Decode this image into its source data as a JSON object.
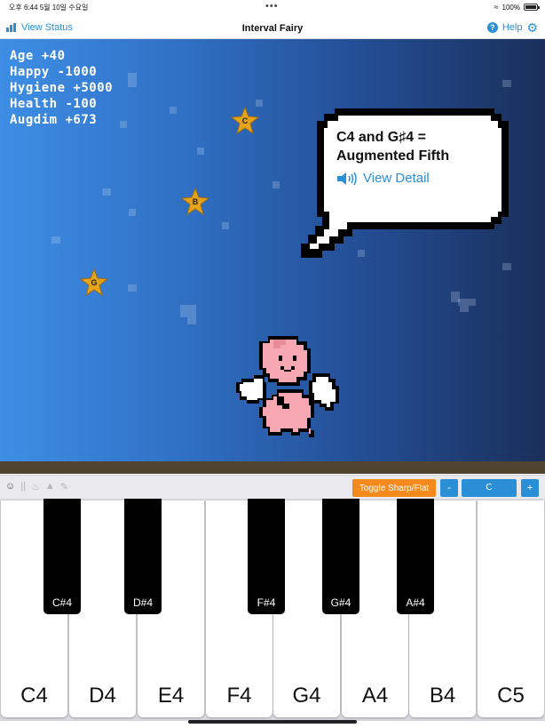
{
  "status_bar": {
    "time": "오후 6:44   5월 10일 수요일",
    "dots": "•••",
    "battery": "100%"
  },
  "nav": {
    "left_label": "View Status",
    "title": "Interval Fairy",
    "help_label": "Help"
  },
  "stats": [
    {
      "text": "Age +40"
    },
    {
      "text": "Happy -1000"
    },
    {
      "text": "Hygiene +5000"
    },
    {
      "text": "Health -100"
    },
    {
      "text": "Augdim +673"
    }
  ],
  "stars": [
    {
      "label": "C"
    },
    {
      "label": "B"
    },
    {
      "label": "G"
    }
  ],
  "bubble": {
    "title_line1": "C4 and G♯4 =",
    "title_line2": "Augmented Fifth",
    "link": "View Detail"
  },
  "toolbar": {
    "icons": [
      "smiley-icon",
      "fork-icon",
      "bath-icon",
      "megaphone-icon",
      "pencil-icon"
    ],
    "toggle_label": "Toggle Sharp/Flat",
    "minus_label": "-",
    "key_value": "C",
    "plus_label": "+"
  },
  "piano": {
    "white_keys": [
      "C4",
      "D4",
      "E4",
      "F4",
      "G4",
      "A4",
      "B4",
      "C5"
    ],
    "black_keys": [
      "C#4",
      "D#4",
      "F#4",
      "G#4",
      "A#4"
    ]
  },
  "colors": {
    "accent": "#2b8fd6",
    "toggle": "#f4891c",
    "sky_left": "#3e8ee6",
    "sky_right": "#1a2f5a",
    "fairy_pink": "#f6a7b2"
  }
}
